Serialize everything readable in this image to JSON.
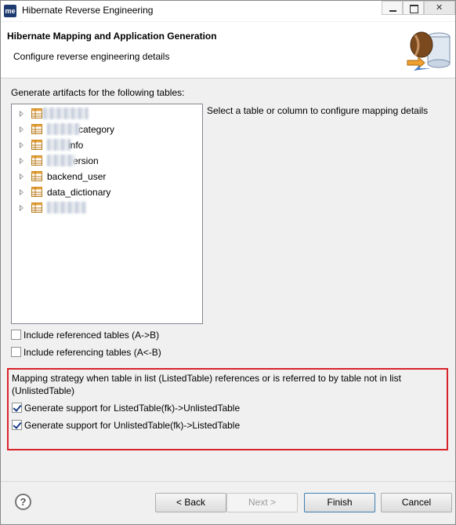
{
  "window": {
    "app_icon_text": "me",
    "title": "Hibernate Reverse Engineering"
  },
  "banner": {
    "title": "Hibernate Mapping and Application Generation",
    "subtitle": "Configure reverse engineering details",
    "icon": "database-coffee-bean-icon"
  },
  "tables_section": {
    "label": "Generate artifacts for the following tables:",
    "items": [
      {
        "label": ""
      },
      {
        "label": "category"
      },
      {
        "label": "info"
      },
      {
        "label": "ersion"
      },
      {
        "label": "backend_user"
      },
      {
        "label": "data_dictionary"
      },
      {
        "label": ""
      }
    ]
  },
  "detail_hint": "Select a table or column to configure mapping details",
  "options": {
    "include_referenced": {
      "label": "Include referenced tables (A->B)",
      "checked": false
    },
    "include_referencing": {
      "label": "Include referencing tables (A<-B)",
      "checked": false
    }
  },
  "strategy": {
    "description": "Mapping strategy when table in list (ListedTable) references or is referred to by table not in list (UnlistedTable)",
    "listed_to_unlisted": {
      "label": "Generate support for ListedTable(fk)->UnlistedTable",
      "checked": true
    },
    "unlisted_to_listed": {
      "label": "Generate support for UnlistedTable(fk)->ListedTable",
      "checked": true
    }
  },
  "buttons": {
    "back": "< Back",
    "next": "Next >",
    "finish": "Finish",
    "cancel": "Cancel"
  },
  "colors": {
    "highlight_border": "#d8232a",
    "checkmark": "#1a3c8a"
  }
}
